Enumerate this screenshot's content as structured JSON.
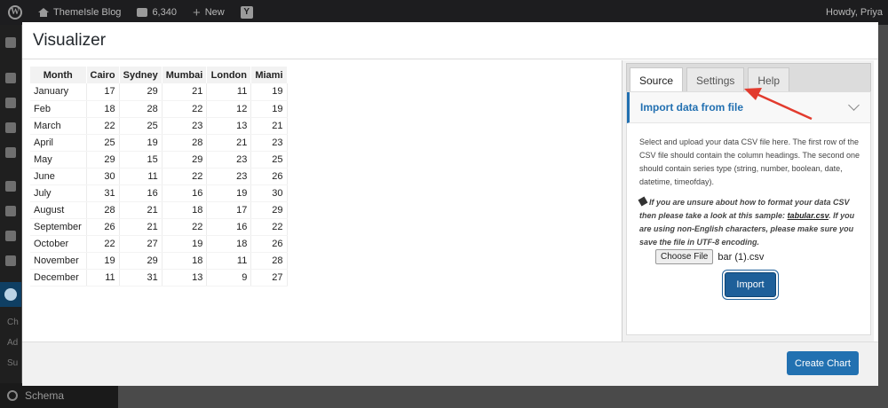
{
  "adminbar": {
    "wp_logo": "W",
    "site_name": "ThemeIsle Blog",
    "comment_count": "6,340",
    "new_label": "New",
    "yoast_letter": "Y",
    "howdy": "Howdy, Priya"
  },
  "sidebar": {
    "partial_labels": [
      "Ch",
      "Ad",
      "Su"
    ],
    "schema_label": "Schema"
  },
  "modal": {
    "title": "Visualizer",
    "create_chart_label": "Create Chart"
  },
  "table": {
    "headers": [
      "Month",
      "Cairo",
      "Sydney",
      "Mumbai",
      "London",
      "Miami"
    ],
    "rows": [
      [
        "January",
        "17",
        "29",
        "21",
        "11",
        "19"
      ],
      [
        "Feb",
        "18",
        "28",
        "22",
        "12",
        "19"
      ],
      [
        "March",
        "22",
        "25",
        "23",
        "13",
        "21"
      ],
      [
        "April",
        "25",
        "19",
        "28",
        "21",
        "23"
      ],
      [
        "May",
        "29",
        "15",
        "29",
        "23",
        "25"
      ],
      [
        "June",
        "30",
        "11",
        "22",
        "23",
        "26"
      ],
      [
        "July",
        "31",
        "16",
        "16",
        "19",
        "30"
      ],
      [
        "August",
        "28",
        "21",
        "18",
        "17",
        "29"
      ],
      [
        "September",
        "26",
        "21",
        "22",
        "16",
        "22"
      ],
      [
        "October",
        "22",
        "27",
        "19",
        "18",
        "26"
      ],
      [
        "November",
        "19",
        "29",
        "18",
        "11",
        "28"
      ],
      [
        "December",
        "11",
        "31",
        "13",
        "9",
        "27"
      ]
    ]
  },
  "panel": {
    "tabs": [
      "Source",
      "Settings",
      "Help"
    ],
    "active_tab": "Source",
    "section_title": "Import data from file",
    "description": "Select and upload your data CSV file here. The first row of the CSV file should contain the column headings. The second one should contain series type (string, number, boolean, date, datetime, timeofday).",
    "tip_before": "If you are unsure about how to format your data CSV then please take a look at this sample: ",
    "tip_link": "tabular.csv",
    "tip_after": ". If you are using non-English characters, please make sure you save the file in UTF-8 encoding.",
    "choose_file_label": "Choose File",
    "file_name": "bar (1).csv",
    "import_label": "Import"
  },
  "colors": {
    "accent": "#2271b1",
    "annotation_arrow": "#e23b2e"
  }
}
